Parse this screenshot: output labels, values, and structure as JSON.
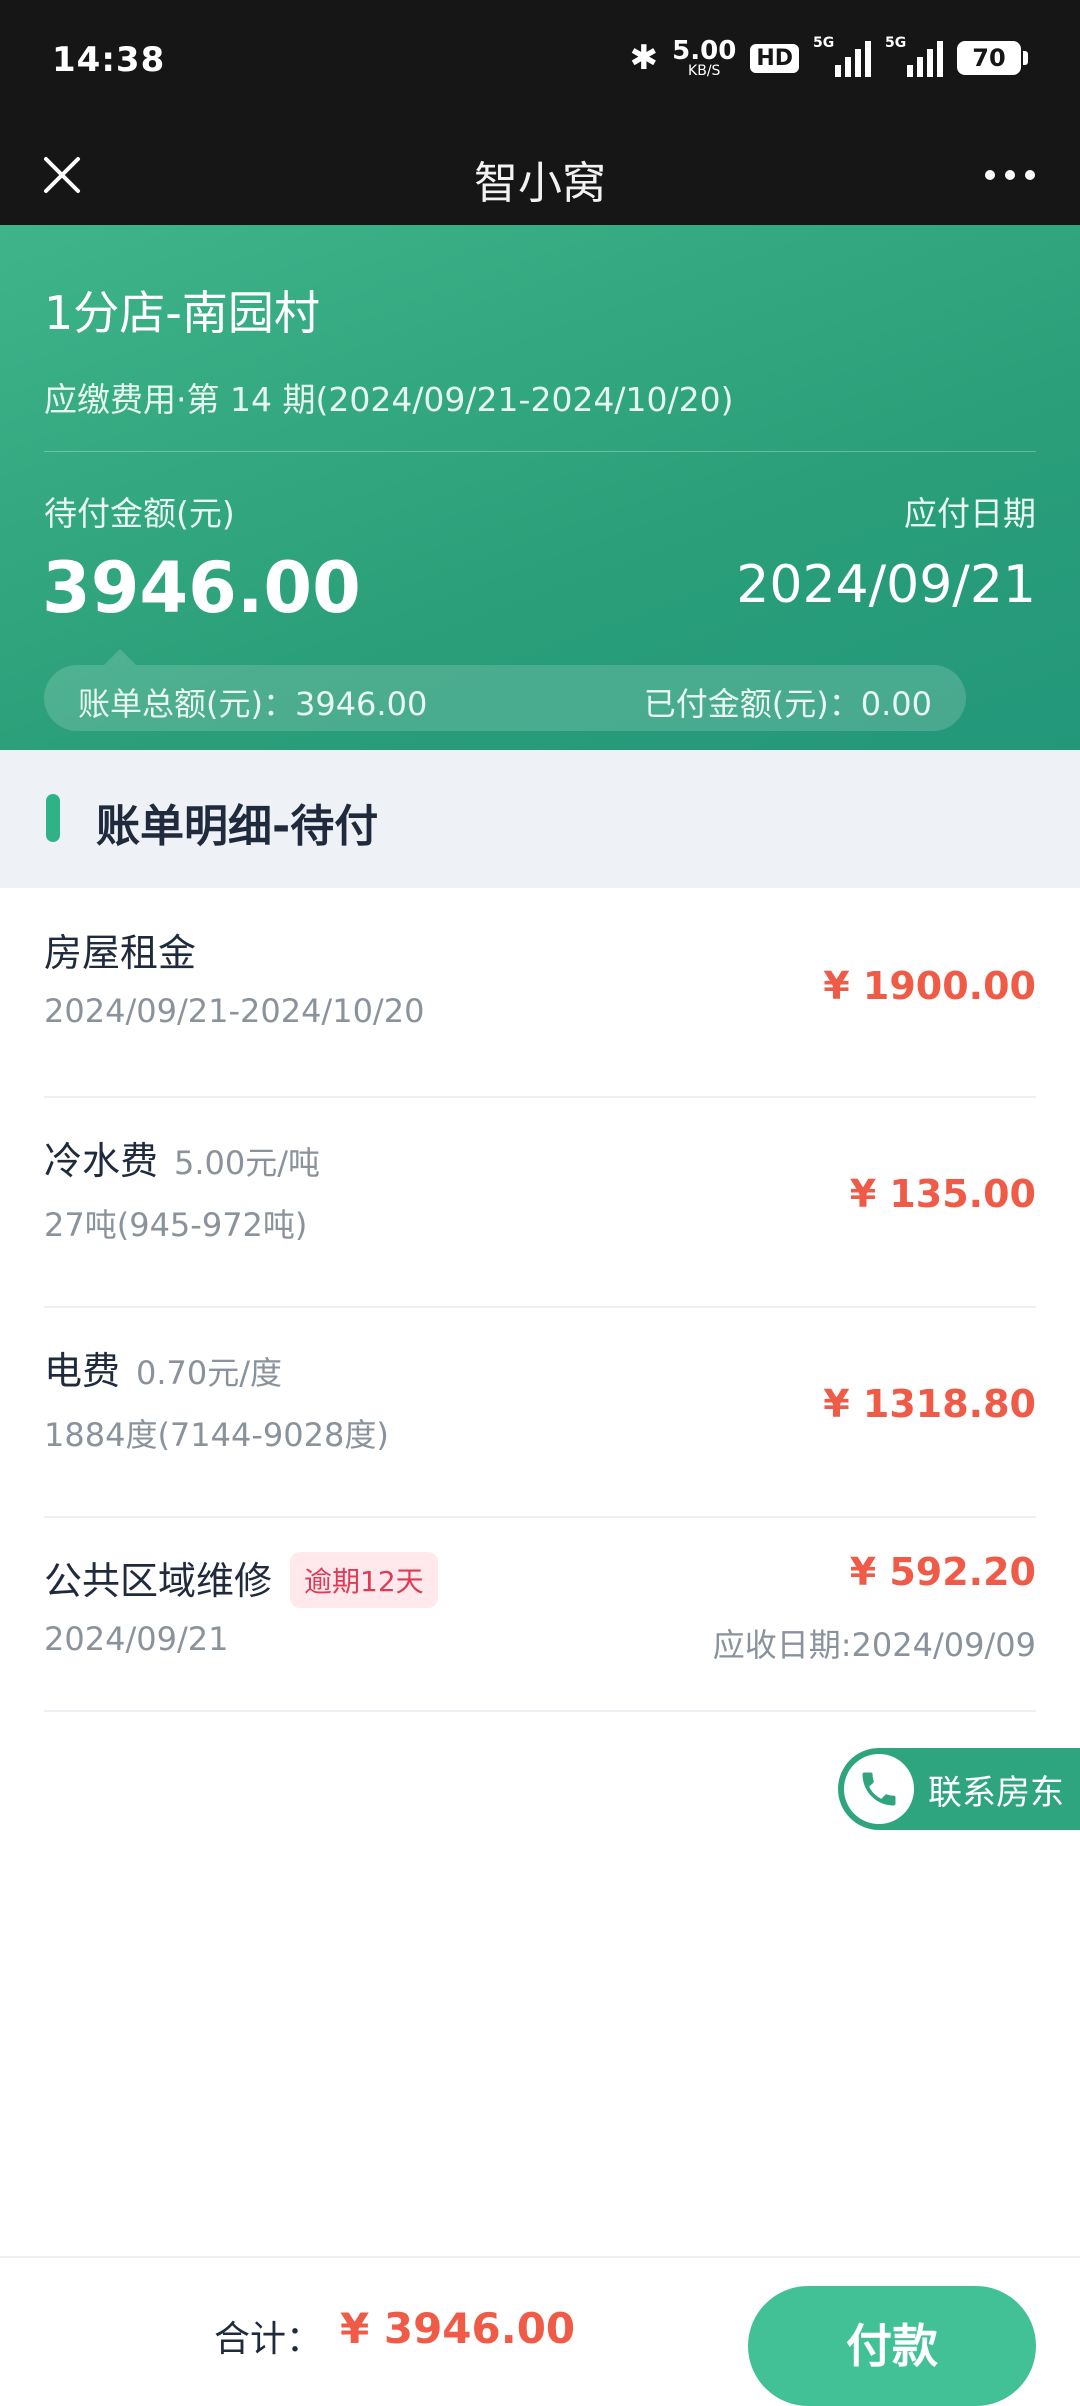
{
  "status_bar": {
    "time": "14:38",
    "net_speed": "5.00",
    "net_speed_unit": "KB/S",
    "hd_label": "HD",
    "signal1_label": "5G",
    "signal2_label": "5G",
    "battery": "70",
    "bluetooth_icon": "bluetooth-icon"
  },
  "nav": {
    "title": "智小窝",
    "close_icon": "close-icon",
    "more_icon": "more-icon"
  },
  "header": {
    "shop_name": "1分店-南园村",
    "period": "应缴费用·第 14 期(2024/09/21-2024/10/20)",
    "pending_label": "待付金额(元)",
    "pending_amount": "3946.00",
    "due_label": "应付日期",
    "due_date": "2024/09/21",
    "bill_total": "账单总额(元)：3946.00",
    "paid_amount": "已付金额(元)：0.00"
  },
  "section": {
    "title": "账单明细-待付"
  },
  "items": [
    {
      "name": "房屋租金",
      "unit_price": "",
      "detail": "2024/09/21-2024/10/20",
      "amount": "¥ 1900.00"
    },
    {
      "name": "冷水费",
      "unit_price": "5.00元/吨",
      "detail": "27吨(945-972吨)",
      "amount": "¥ 135.00"
    },
    {
      "name": "电费",
      "unit_price": "0.70元/度",
      "detail": "1884度(7144-9028度)",
      "amount": "¥ 1318.80"
    },
    {
      "name": "公共区域维修",
      "badge": "逾期12天",
      "detail": "2024/09/21",
      "amount": "¥ 592.20",
      "due_text": "应收日期:2024/09/09"
    }
  ],
  "contact": {
    "label": "联系房东",
    "icon": "phone-icon"
  },
  "footer": {
    "total_label": "合计：",
    "total_amount": "¥ 3946.00",
    "pay_label": "付款"
  },
  "colors": {
    "brand_green": "#2fb386",
    "amount_red": "#ef5b47",
    "overdue_red": "#e03b56"
  }
}
